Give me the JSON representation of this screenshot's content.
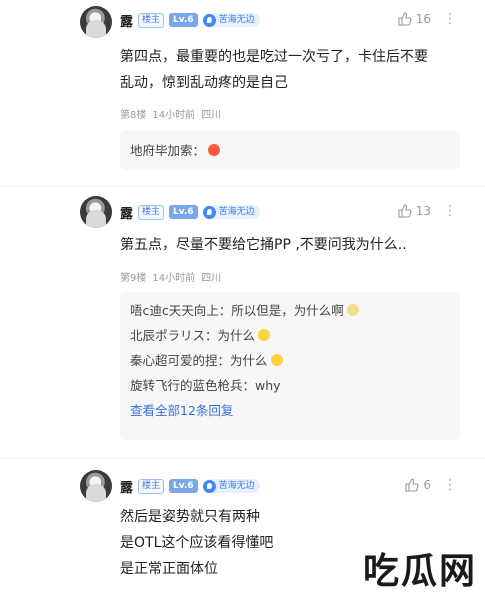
{
  "posts": [
    {
      "username": "露",
      "op_badge": "楼主",
      "level": "Lv.6",
      "group": "苦海无边",
      "likes": "16",
      "content": [
        "第四点，最重要的也是吃过一次亏了，卡住后不要",
        "乱动，惊到乱动疼的是自己"
      ],
      "floor": "第8楼",
      "time": "14小时前",
      "location": "四川",
      "replies": [
        {
          "text": "地府毕加索：",
          "emoji": "red-emoji"
        }
      ]
    },
    {
      "username": "露",
      "op_badge": "楼主",
      "level": "Lv.6",
      "group": "苦海无边",
      "likes": "13",
      "content": [
        "第五点，尽量不要给它捅PP ,不要问我为什么.."
      ],
      "floor": "第9楼",
      "time": "14小时前",
      "location": "四川",
      "replies": [
        {
          "text": "唔c迪c天天向上：所以但是，为什么啊",
          "emoji": "yellow-emoji"
        },
        {
          "text": "北辰ポラリス：为什么",
          "emoji": "yellow-emoji"
        },
        {
          "text": "秦心超可爱的捏：为什么",
          "emoji": "yellow-emoji"
        },
        {
          "text": "旋转飞行的蓝色枪兵：why",
          "emoji": ""
        }
      ],
      "view_all": "查看全部12条回复"
    },
    {
      "username": "露",
      "op_badge": "楼主",
      "level": "Lv.6",
      "group": "苦海无边",
      "likes": "6",
      "content": [
        "然后是姿势就只有两种",
        "是OTL这个应该看得懂吧",
        "是正常正面体位"
      ]
    }
  ],
  "watermark": "吃瓜网"
}
